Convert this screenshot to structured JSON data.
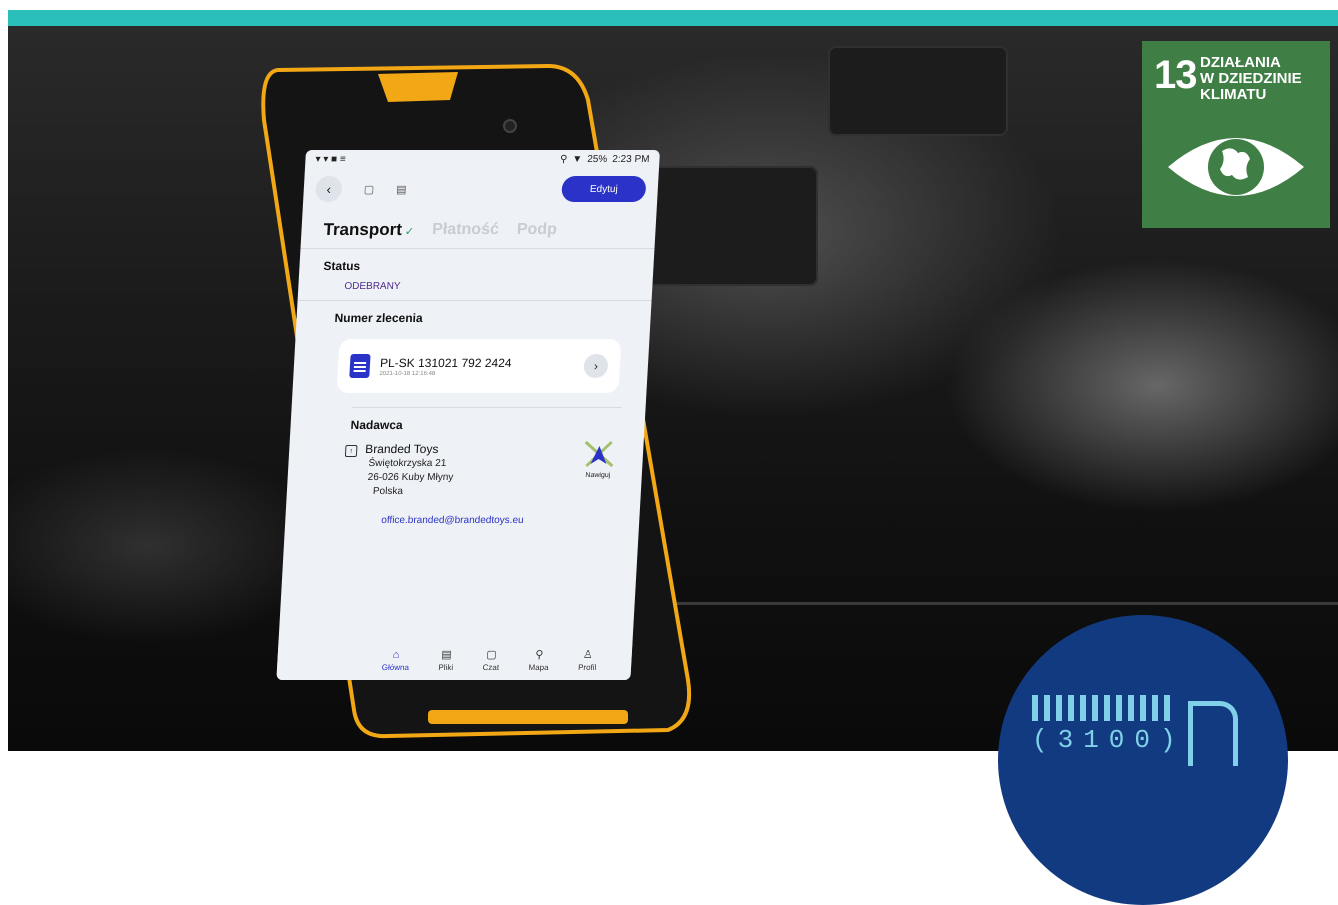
{
  "statusbar": {
    "battery": "25%",
    "time": "2:23 PM"
  },
  "appbar": {
    "edit_label": "Edytuj"
  },
  "tabs": {
    "active": "Transport",
    "second": "Płatność",
    "third": "Podp"
  },
  "status": {
    "label": "Status",
    "value": "ODEBRANY"
  },
  "order": {
    "label": "Numer zlecenia",
    "number": "PL-SK 131021 792 2424",
    "date": "2021-10-18 12:16:48"
  },
  "sender": {
    "label": "Nadawca",
    "name": "Branded Toys",
    "street": "Świętokrzyska 21",
    "city": "26-026 Kuby Młyny",
    "country": "Polska",
    "email": "office.branded@brandedtoys.eu",
    "nav_label": "Nawiguj"
  },
  "bottom_nav": [
    {
      "label": "Główna",
      "icon": "home-icon"
    },
    {
      "label": "Pliki",
      "icon": "files-icon"
    },
    {
      "label": "Czat",
      "icon": "chat-icon"
    },
    {
      "label": "Mapa",
      "icon": "map-pin-icon"
    },
    {
      "label": "Profil",
      "icon": "profile-icon"
    }
  ],
  "sdg": {
    "number": "13",
    "line1": "DZIAŁANIA",
    "line2": "W DZIEDZINIE",
    "line3": "KLIMATU"
  },
  "logo": {
    "code": "(3100)"
  },
  "colors": {
    "stripe": "#2bbfbb",
    "accent": "#2a32c8",
    "sdg_green": "#3f7e44",
    "logo_blue": "#123a80",
    "phone_yellow": "#f2a814"
  }
}
